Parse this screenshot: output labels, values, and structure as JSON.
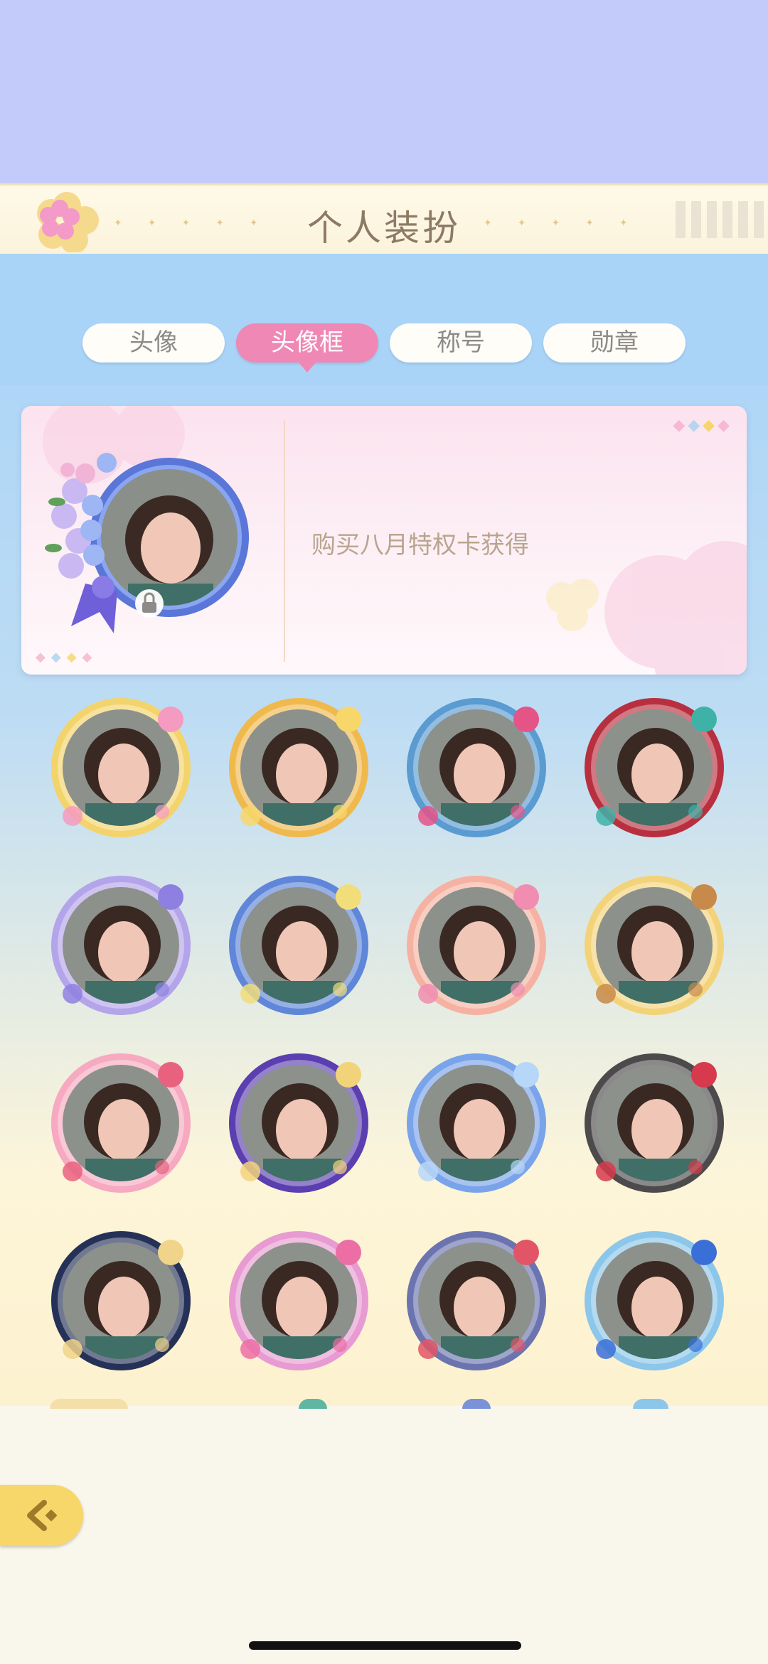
{
  "header": {
    "title": "个人装扮"
  },
  "tabs": [
    {
      "label": "头像",
      "active": false
    },
    {
      "label": "头像框",
      "active": true
    },
    {
      "label": "称号",
      "active": false
    },
    {
      "label": "勋章",
      "active": false
    }
  ],
  "selected_frame": {
    "locked": true,
    "source_text": "购买八月特权卡获得"
  },
  "frames": [
    {
      "name": "frame-yellow-bow-wings",
      "ring": "#f3d36b",
      "accent": "#f59ac1"
    },
    {
      "name": "frame-gold-flowers",
      "ring": "#f0b94d",
      "accent": "#f7d76a"
    },
    {
      "name": "frame-teal-roses",
      "ring": "#5a9bd1",
      "accent": "#e55487"
    },
    {
      "name": "frame-crimson-butterfly",
      "ring": "#b8303f",
      "accent": "#3fb2a8"
    },
    {
      "name": "frame-lilac-music",
      "ring": "#b4a4ea",
      "accent": "#8e80e0"
    },
    {
      "name": "frame-blue-soccer",
      "ring": "#5f86d8",
      "accent": "#f1dd7a"
    },
    {
      "name": "frame-peach-bunny",
      "ring": "#f5b2a2",
      "accent": "#f08db0"
    },
    {
      "name": "frame-bear-ears",
      "ring": "#f3d37a",
      "accent": "#c88a4a"
    },
    {
      "name": "frame-pink-roses",
      "ring": "#f6a9c0",
      "accent": "#e8627f"
    },
    {
      "name": "frame-navy-moon",
      "ring": "#5b3fb0",
      "accent": "#f3d37a"
    },
    {
      "name": "frame-ocean-waves",
      "ring": "#7aa4ea",
      "accent": "#b6d7f7"
    },
    {
      "name": "frame-dark-thorns",
      "ring": "#4d4a4c",
      "accent": "#d63a4c"
    },
    {
      "name": "frame-navy-stars",
      "ring": "#263158",
      "accent": "#f0d48a"
    },
    {
      "name": "frame-pink-camellia",
      "ring": "#e79bd2",
      "accent": "#ec6ea5"
    },
    {
      "name": "frame-purple-bear",
      "ring": "#6c74b0",
      "accent": "#e25566"
    },
    {
      "name": "frame-crystal-wings",
      "ring": "#8cc6ea",
      "accent": "#3b6fd8"
    }
  ],
  "colors": {
    "tab_active": "#ef88b5",
    "back_button": "#f7d76a",
    "title_text": "#8d7a64"
  }
}
